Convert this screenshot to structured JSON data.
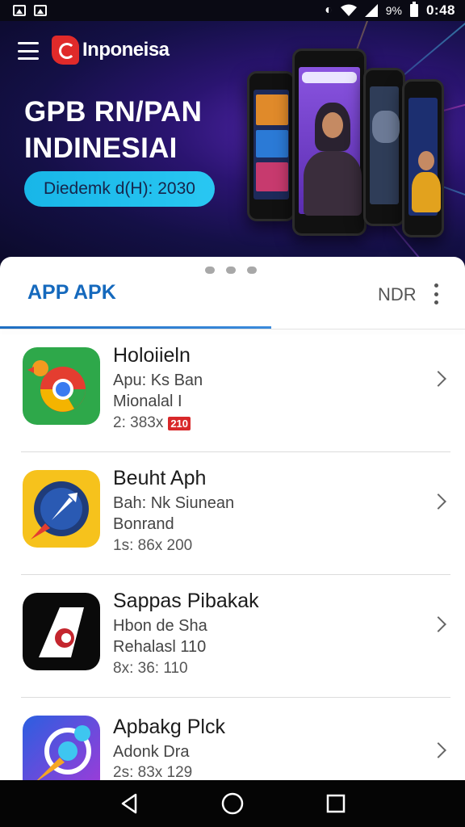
{
  "status_bar": {
    "time": "0:48",
    "battery_text": "9%",
    "icons": [
      "image-icon",
      "gallery-icon",
      "data-saver-icon",
      "wifi-icon",
      "signal-icon",
      "battery-icon"
    ]
  },
  "banner": {
    "brand_name": "Inponeisa",
    "headline_line1": "GPB RN/PAN",
    "headline_line2": "INDINESIAI",
    "pill_text": "Diedemk d(H): 2030",
    "colors": {
      "pill": "#1fbde9",
      "logo": "#e02a2a",
      "background": "#141046"
    }
  },
  "tabs": {
    "active_label": "APP APK",
    "secondary_label": "NDR",
    "accent_color": "#1569bd"
  },
  "apps": [
    {
      "title": "Holoiieln",
      "line1": "Apu: Ks Ban",
      "line2": "Mionalal I",
      "meta": "2: 383x",
      "badge": "210",
      "icon": "chrome-bird-icon"
    },
    {
      "title": "Beuht Aph",
      "line1": "Bah: Nk Siunean",
      "line2": "Bonrand",
      "meta": "1s: 86x 200",
      "badge": "",
      "icon": "compass-arrow-icon"
    },
    {
      "title": "Sappas Pibakak",
      "line1": "Hbon de Sha",
      "line2": "Rehalasl 110",
      "meta": "8x: 36: 110",
      "badge": "",
      "icon": "letter-a-icon"
    },
    {
      "title": "Apbakg Plck",
      "line1": "Adonk Dra",
      "line2": "",
      "meta": "2s: 83x 129",
      "badge": "",
      "icon": "target-arrow-icon"
    }
  ]
}
